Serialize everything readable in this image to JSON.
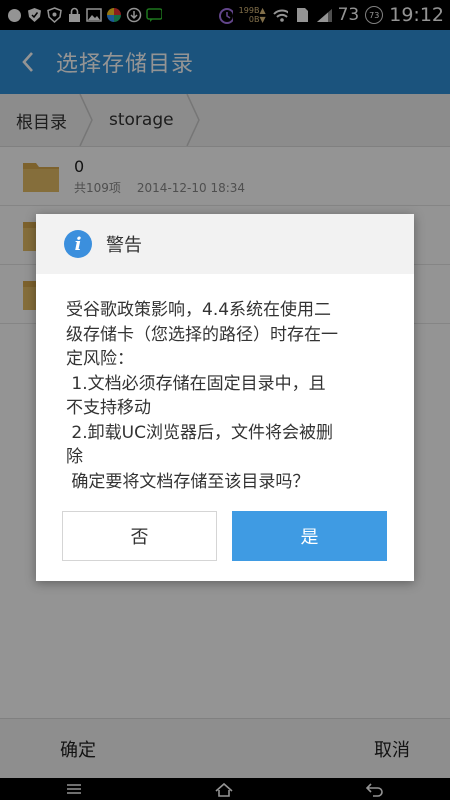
{
  "status_bar": {
    "net_speed_line1": "199B",
    "net_speed_line2": "0B",
    "signal": "73",
    "badge": "73",
    "time": "19:12",
    "icons": [
      "circle-icon",
      "shield-icon",
      "shield-icon",
      "lock-icon",
      "image-icon",
      "app-icon",
      "download-icon",
      "chat-icon",
      "alarm-icon",
      "wifi-icon",
      "sd-icon",
      "signal-icon"
    ]
  },
  "header": {
    "title": "选择存储目录"
  },
  "breadcrumb": [
    "根目录",
    "storage"
  ],
  "files": [
    {
      "name": "0",
      "count": "共109项",
      "date": "2014-12-10 18:34"
    },
    {
      "name": "",
      "count": "",
      "date": ""
    },
    {
      "name": "",
      "count": "",
      "date": ""
    }
  ],
  "dialog": {
    "title": "警告",
    "lines": [
      "受谷歌政策影响，4.4系统在使用二",
      "级存储卡（您选择的路径）时存在一",
      "定风险：",
      " 1.文档必须存储在固定目录中，且",
      "不支持移动",
      " 2.卸载UC浏览器后，文件将会被删",
      "除",
      " 确定要将文档存储至该目录吗？"
    ],
    "no_label": "否",
    "yes_label": "是"
  },
  "bottom_bar": {
    "confirm_label": "确定",
    "cancel_label": "取消"
  },
  "colors": {
    "primary": "#2f8fd8",
    "yes_button": "#3f9be3",
    "folder": "#e2b75e"
  }
}
